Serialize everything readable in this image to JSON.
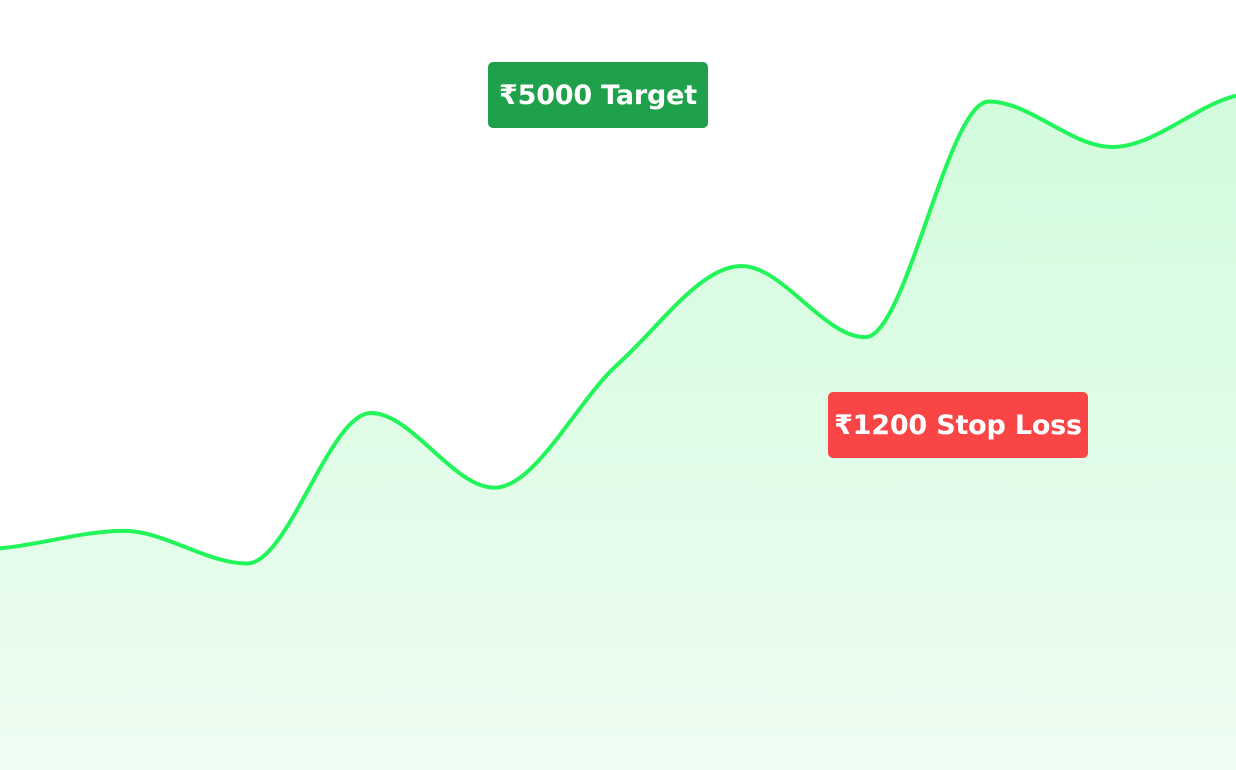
{
  "chart_data": {
    "type": "area",
    "title": "",
    "xlabel": "",
    "ylabel": "",
    "grid": false,
    "legend": "none",
    "x": [
      0,
      1,
      2,
      3,
      4,
      5,
      6,
      7,
      8,
      9,
      10
    ],
    "values": [
      1900,
      2050,
      1770,
      3060,
      2420,
      3480,
      4320,
      3710,
      5730,
      5340,
      5780
    ],
    "ylim": [
      0,
      6600
    ],
    "line_color": "#22f55a",
    "fill_color_top": "#d2fbdc",
    "fill_color_bottom": "#eefdf2"
  },
  "annotations": [
    {
      "text": "₹5000 Target",
      "color": "#1fa04b"
    },
    {
      "text": "₹1200 Stop Loss",
      "color": "#f94545"
    }
  ]
}
